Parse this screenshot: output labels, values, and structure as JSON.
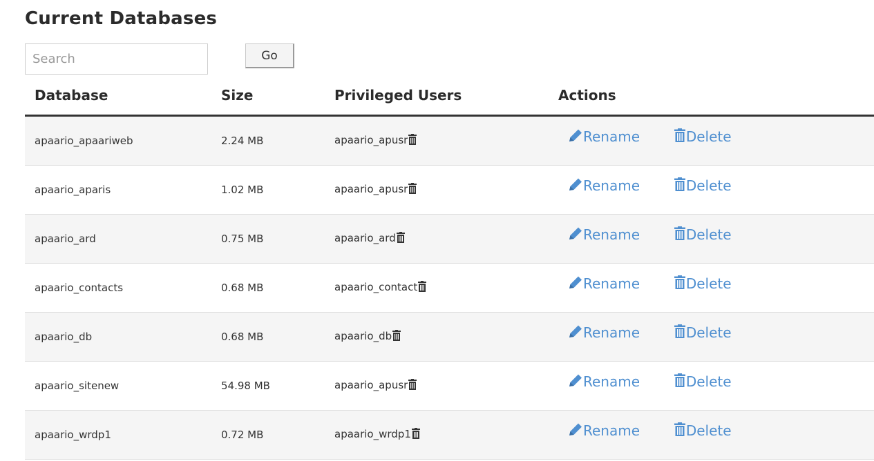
{
  "page": {
    "title": "Current Databases"
  },
  "search": {
    "placeholder": "Search",
    "value": "",
    "go_label": "Go"
  },
  "table": {
    "headers": {
      "database": "Database",
      "size": "Size",
      "privileged_users": "Privileged Users",
      "actions": "Actions"
    },
    "rows": [
      {
        "database": "apaario_apaariweb",
        "size": "2.24 MB",
        "user": "apaario_apusr"
      },
      {
        "database": "apaario_aparis",
        "size": "1.02 MB",
        "user": "apaario_apusr"
      },
      {
        "database": "apaario_ard",
        "size": "0.75 MB",
        "user": "apaario_ard"
      },
      {
        "database": "apaario_contacts",
        "size": "0.68 MB",
        "user": "apaario_contact"
      },
      {
        "database": "apaario_db",
        "size": "0.68 MB",
        "user": "apaario_db"
      },
      {
        "database": "apaario_sitenew",
        "size": "54.98 MB",
        "user": "apaario_apusr"
      },
      {
        "database": "apaario_wrdp1",
        "size": "0.72 MB",
        "user": "apaario_wrdp1"
      }
    ]
  },
  "actions": {
    "rename_label": "Rename",
    "delete_label": "Delete"
  },
  "icons": {
    "rename": "pencil-icon",
    "delete": "trash-icon",
    "remove_user": "trash-icon"
  },
  "colors": {
    "link": "#4f8fd0",
    "row_stripe": "#f5f5f5",
    "header_rule": "#333333",
    "user_trash": "#333333"
  }
}
